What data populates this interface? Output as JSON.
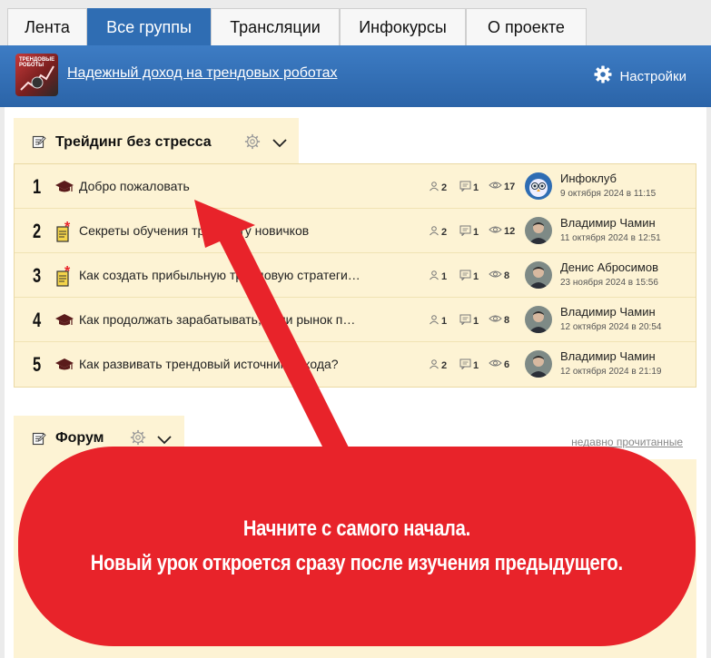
{
  "tabs": [
    {
      "label": "Лента",
      "active": false
    },
    {
      "label": "Все группы",
      "active": true
    },
    {
      "label": "Трансляции",
      "active": false
    },
    {
      "label": "Инфокурсы",
      "active": false
    },
    {
      "label": "О проекте",
      "active": false
    }
  ],
  "header": {
    "group_name": "Надежный доход на трендовых роботах",
    "logo_text": "ТРЕНДОВЫЕ РОБОТЫ",
    "settings_label": "Настройки",
    "background_color": "#3573b9"
  },
  "section": {
    "title": "Трейдинг без стресса",
    "rows": [
      {
        "num": "1",
        "icon": "graduation-cap-icon",
        "title": "Добро пожаловать",
        "participants": "2",
        "comments": "1",
        "views": "17",
        "author": "Инфоклуб",
        "date": "9 октября 2024 в 11:15",
        "avatar": "owl-avatar"
      },
      {
        "num": "2",
        "icon": "notepad-icon",
        "title": "Секреты обучения трейдингу новичков",
        "participants": "2",
        "comments": "1",
        "views": "12",
        "author": "Владимир Чамин",
        "date": "11 октября 2024 в 12:51",
        "avatar": "person-avatar"
      },
      {
        "num": "3",
        "icon": "notepad-icon",
        "title": "Как создать прибыльную трендовую стратеги…",
        "participants": "1",
        "comments": "1",
        "views": "8",
        "author": "Денис Абросимов",
        "date": "23 ноября 2024 в 15:56",
        "avatar": "person-avatar"
      },
      {
        "num": "4",
        "icon": "graduation-cap-icon",
        "title": "Как продолжать зарабатывать, если рынок п…",
        "participants": "1",
        "comments": "1",
        "views": "8",
        "author": "Владимир Чамин",
        "date": "12 октября 2024 в 20:54",
        "avatar": "person-avatar"
      },
      {
        "num": "5",
        "icon": "graduation-cap-icon",
        "title": "Как развивать трендовый источник дохода?",
        "participants": "2",
        "comments": "1",
        "views": "6",
        "author": "Владимир Чамин",
        "date": "12 октября 2024 в 21:19",
        "avatar": "person-avatar"
      }
    ]
  },
  "forum": {
    "title": "Форум",
    "recent_link": "недавно прочитанные"
  },
  "annotation": {
    "line1": "Начните с самого начала.",
    "line2": "Новый урок откроется сразу после изучения предыдущего.",
    "color": "#e8232a"
  }
}
